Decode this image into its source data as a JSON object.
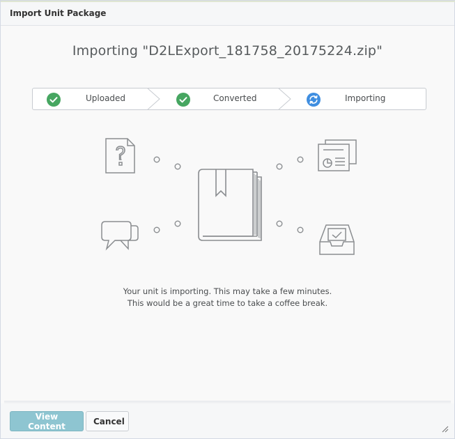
{
  "dialog": {
    "title": "Import Unit Package"
  },
  "main": {
    "heading": "Importing \"D2LExport_181758_20175224.zip\"",
    "steps": [
      {
        "label": "Uploaded",
        "status": "complete",
        "icon": "check-icon"
      },
      {
        "label": "Converted",
        "status": "complete",
        "icon": "check-icon"
      },
      {
        "label": "Importing",
        "status": "in-progress",
        "icon": "sync-icon"
      }
    ],
    "message_line1": "Your unit is importing. This may take a few minutes.",
    "message_line2": "This would be a great time to take a coffee break."
  },
  "illustration_icons": [
    "quiz-icon",
    "presentation-icon",
    "book-icon",
    "discussion-icon",
    "dropbox-icon"
  ],
  "footer": {
    "primary_label": "View Content",
    "cancel_label": "Cancel"
  },
  "colors": {
    "complete": "#46a661",
    "in_progress": "#3f8ee0",
    "primary_button": "#8ec5d1"
  }
}
